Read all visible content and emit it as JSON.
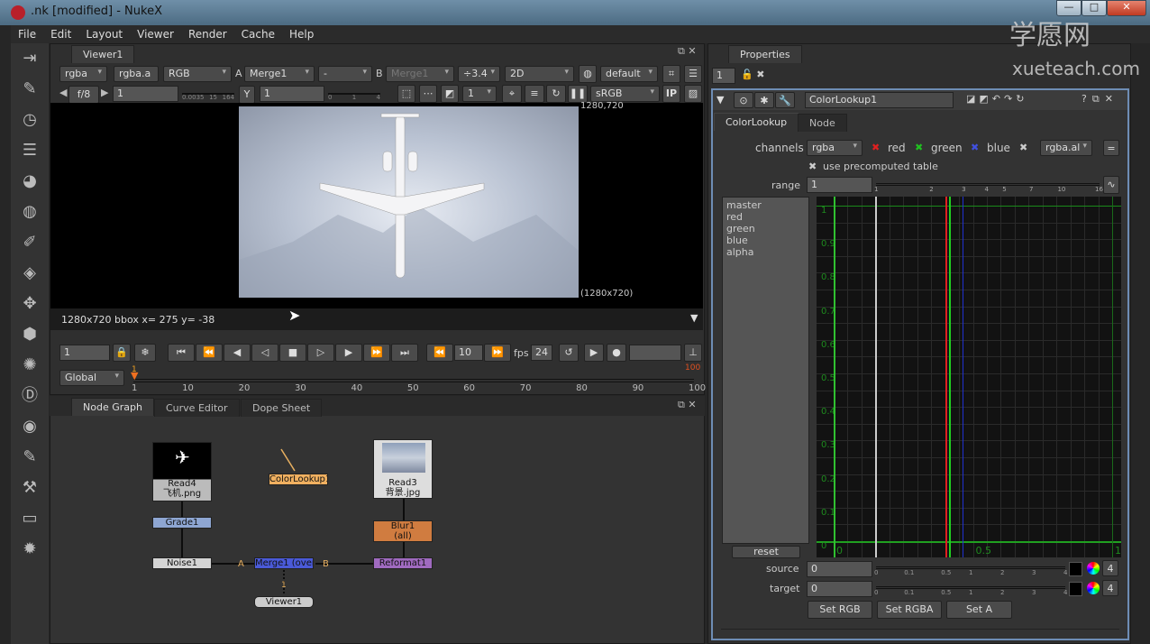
{
  "window": {
    "title": ".nk [modified] - NukeX",
    "min": "—",
    "max": "□",
    "close": "✕"
  },
  "menu": [
    "File",
    "Edit",
    "Layout",
    "Viewer",
    "Render",
    "Cache",
    "Help"
  ],
  "watermark": {
    "cn": "学愿网",
    "en": "xueteach.com"
  },
  "left_toolbar": [
    "image-icon",
    "draw-icon",
    "time-icon",
    "channel-icon",
    "color-icon",
    "filter-icon",
    "keyer-icon",
    "merge-icon",
    "transform-icon",
    "3d-icon",
    "particles-icon",
    "deep-icon",
    "views-icon",
    "metadata-icon",
    "toolsets-icon",
    "other-icon",
    "furnace-icon"
  ],
  "viewer": {
    "tab": "Viewer1",
    "channels": "rgba",
    "alpha": "rgba.a",
    "display": "RGB",
    "a_label": "A",
    "a_input": "Merge1",
    "op": "-",
    "b_label": "B",
    "b_input": "Merge1",
    "downscale": "÷3.4",
    "mode": "2D",
    "lut_default": "default",
    "fstop": "f/8",
    "gain": "1",
    "gain_ticks": [
      "0.0035",
      "15",
      "164"
    ],
    "gamma_label": "Y",
    "gamma": "1",
    "gamma_ticks": [
      "0",
      "1",
      "4"
    ],
    "proxy": "1",
    "colorspace": "sRGB",
    "ip": "IP",
    "corner_top": "1280,720",
    "corner_bottom": "(1280x720)",
    "info": "1280x720 bbox  x= 275 y= -38",
    "frame": "1",
    "inc": "10",
    "fps_label": "fps",
    "fps": "24",
    "scope": "Global",
    "timeline_ticks": [
      "1",
      "10",
      "20",
      "30",
      "40",
      "50",
      "60",
      "70",
      "80",
      "90",
      "100"
    ],
    "in_marker": "1",
    "out_marker": "100"
  },
  "nodegraph": {
    "tabs": [
      "Node Graph",
      "Curve Editor",
      "Dope Sheet"
    ],
    "nodes": {
      "read4": "Read4",
      "read4_file": "飞机.png",
      "grade": "Grade1",
      "noise": "Noise1",
      "merge": "Merge1 (over)",
      "colorlookup": "ColorLookup1",
      "read3": "Read3",
      "read3_file": "背景.jpg",
      "blur": "Blur1",
      "blur_sub": "(all)",
      "reformat": "Reformat1",
      "viewer": "Viewer1"
    },
    "labels": {
      "a": "A",
      "b": "B",
      "one": "1"
    }
  },
  "properties": {
    "tab": "Properties",
    "max_panels": "1",
    "node_name": "ColorLookup1",
    "tabs": [
      "ColorLookup",
      "Node"
    ],
    "channels_label": "channels",
    "channels": "rgba",
    "red": "red",
    "green": "green",
    "blue": "blue",
    "alpha_ch": "rgba.al",
    "eq": "=",
    "precomp": "use precomputed table",
    "range_label": "range",
    "range": "1",
    "range_ticks": [
      "1",
      "2",
      "3",
      "4",
      "5",
      "7",
      "10",
      "16"
    ],
    "curves": [
      "master",
      "red",
      "green",
      "blue",
      "alpha"
    ],
    "reset": "reset",
    "y_ticks": [
      "1",
      "0.9",
      "0.8",
      "0.7",
      "0.6",
      "0.5",
      "0.4",
      "0.3",
      "0.2",
      "0.1",
      "0"
    ],
    "x_ticks": [
      "0",
      "0.5",
      "1"
    ],
    "source_label": "source",
    "source": "0",
    "target_label": "target",
    "target": "0",
    "slider_ticks": [
      "0",
      "0.1",
      "0.5",
      "1",
      "2",
      "3",
      "4"
    ],
    "channels_count": "4",
    "set_rgb": "Set RGB",
    "set_rgba": "Set RGBA",
    "set_a": "Set A",
    "colors": {
      "red": "#e02020",
      "green": "#20d020",
      "blue": "#2030d0",
      "bg": "#121212"
    }
  }
}
